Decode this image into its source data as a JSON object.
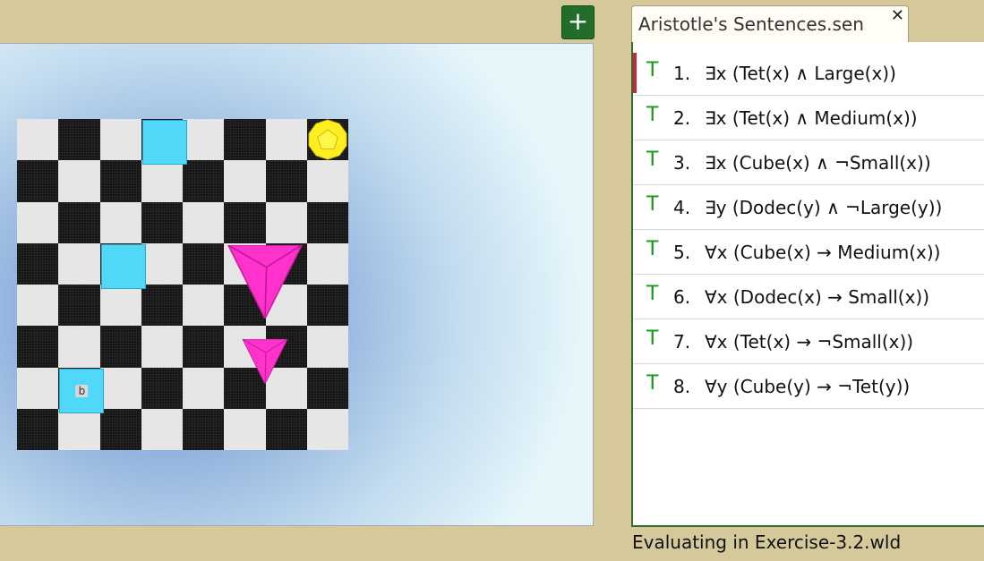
{
  "toolbar": {
    "add_label": "+"
  },
  "tab": {
    "title": "Aristotle's Sentences.sen",
    "close_label": "✕"
  },
  "world": {
    "board_size": 8,
    "blocks": [
      {
        "type": "cube",
        "size": "medium",
        "color": "#4fd8f8",
        "col": 4,
        "row": 1,
        "label": ""
      },
      {
        "type": "cube",
        "size": "medium",
        "color": "#4fd8f8",
        "col": 3,
        "row": 4,
        "label": ""
      },
      {
        "type": "cube",
        "size": "medium",
        "color": "#4fd8f8",
        "col": 2,
        "row": 7,
        "label": "b"
      },
      {
        "type": "dodec",
        "size": "small",
        "color": "#ffee22",
        "col": 8,
        "row": 1,
        "label": ""
      },
      {
        "type": "tet",
        "size": "large",
        "color": "#ff33cc",
        "col": 6,
        "row": 4,
        "label": ""
      },
      {
        "type": "tet",
        "size": "medium",
        "color": "#ff33cc",
        "col": 6,
        "row": 6,
        "label": ""
      }
    ]
  },
  "sentences": [
    {
      "truth": "T",
      "num": "1.",
      "formula": "∃x (Tet(x) ∧ Large(x))",
      "selected": true
    },
    {
      "truth": "T",
      "num": "2.",
      "formula": "∃x (Tet(x) ∧ Medium(x))"
    },
    {
      "truth": "T",
      "num": "3.",
      "formula": "∃x (Cube(x) ∧ ¬Small(x))"
    },
    {
      "truth": "T",
      "num": "4.",
      "formula": "∃y (Dodec(y) ∧ ¬Large(y))"
    },
    {
      "truth": "T",
      "num": "5.",
      "formula": "∀x (Cube(x) → Medium(x))"
    },
    {
      "truth": "T",
      "num": "6.",
      "formula": "∀x (Dodec(x) → Small(x))"
    },
    {
      "truth": "T",
      "num": "7.",
      "formula": "∀x (Tet(x) → ¬Small(x))"
    },
    {
      "truth": "T",
      "num": "8.",
      "formula": "∀y (Cube(y) → ¬Tet(y))"
    }
  ],
  "status": {
    "text": "Evaluating in Exercise-3.2.wld"
  },
  "colors": {
    "true": "#159815",
    "selection": "#c8283a",
    "background": "#d5c89b"
  }
}
